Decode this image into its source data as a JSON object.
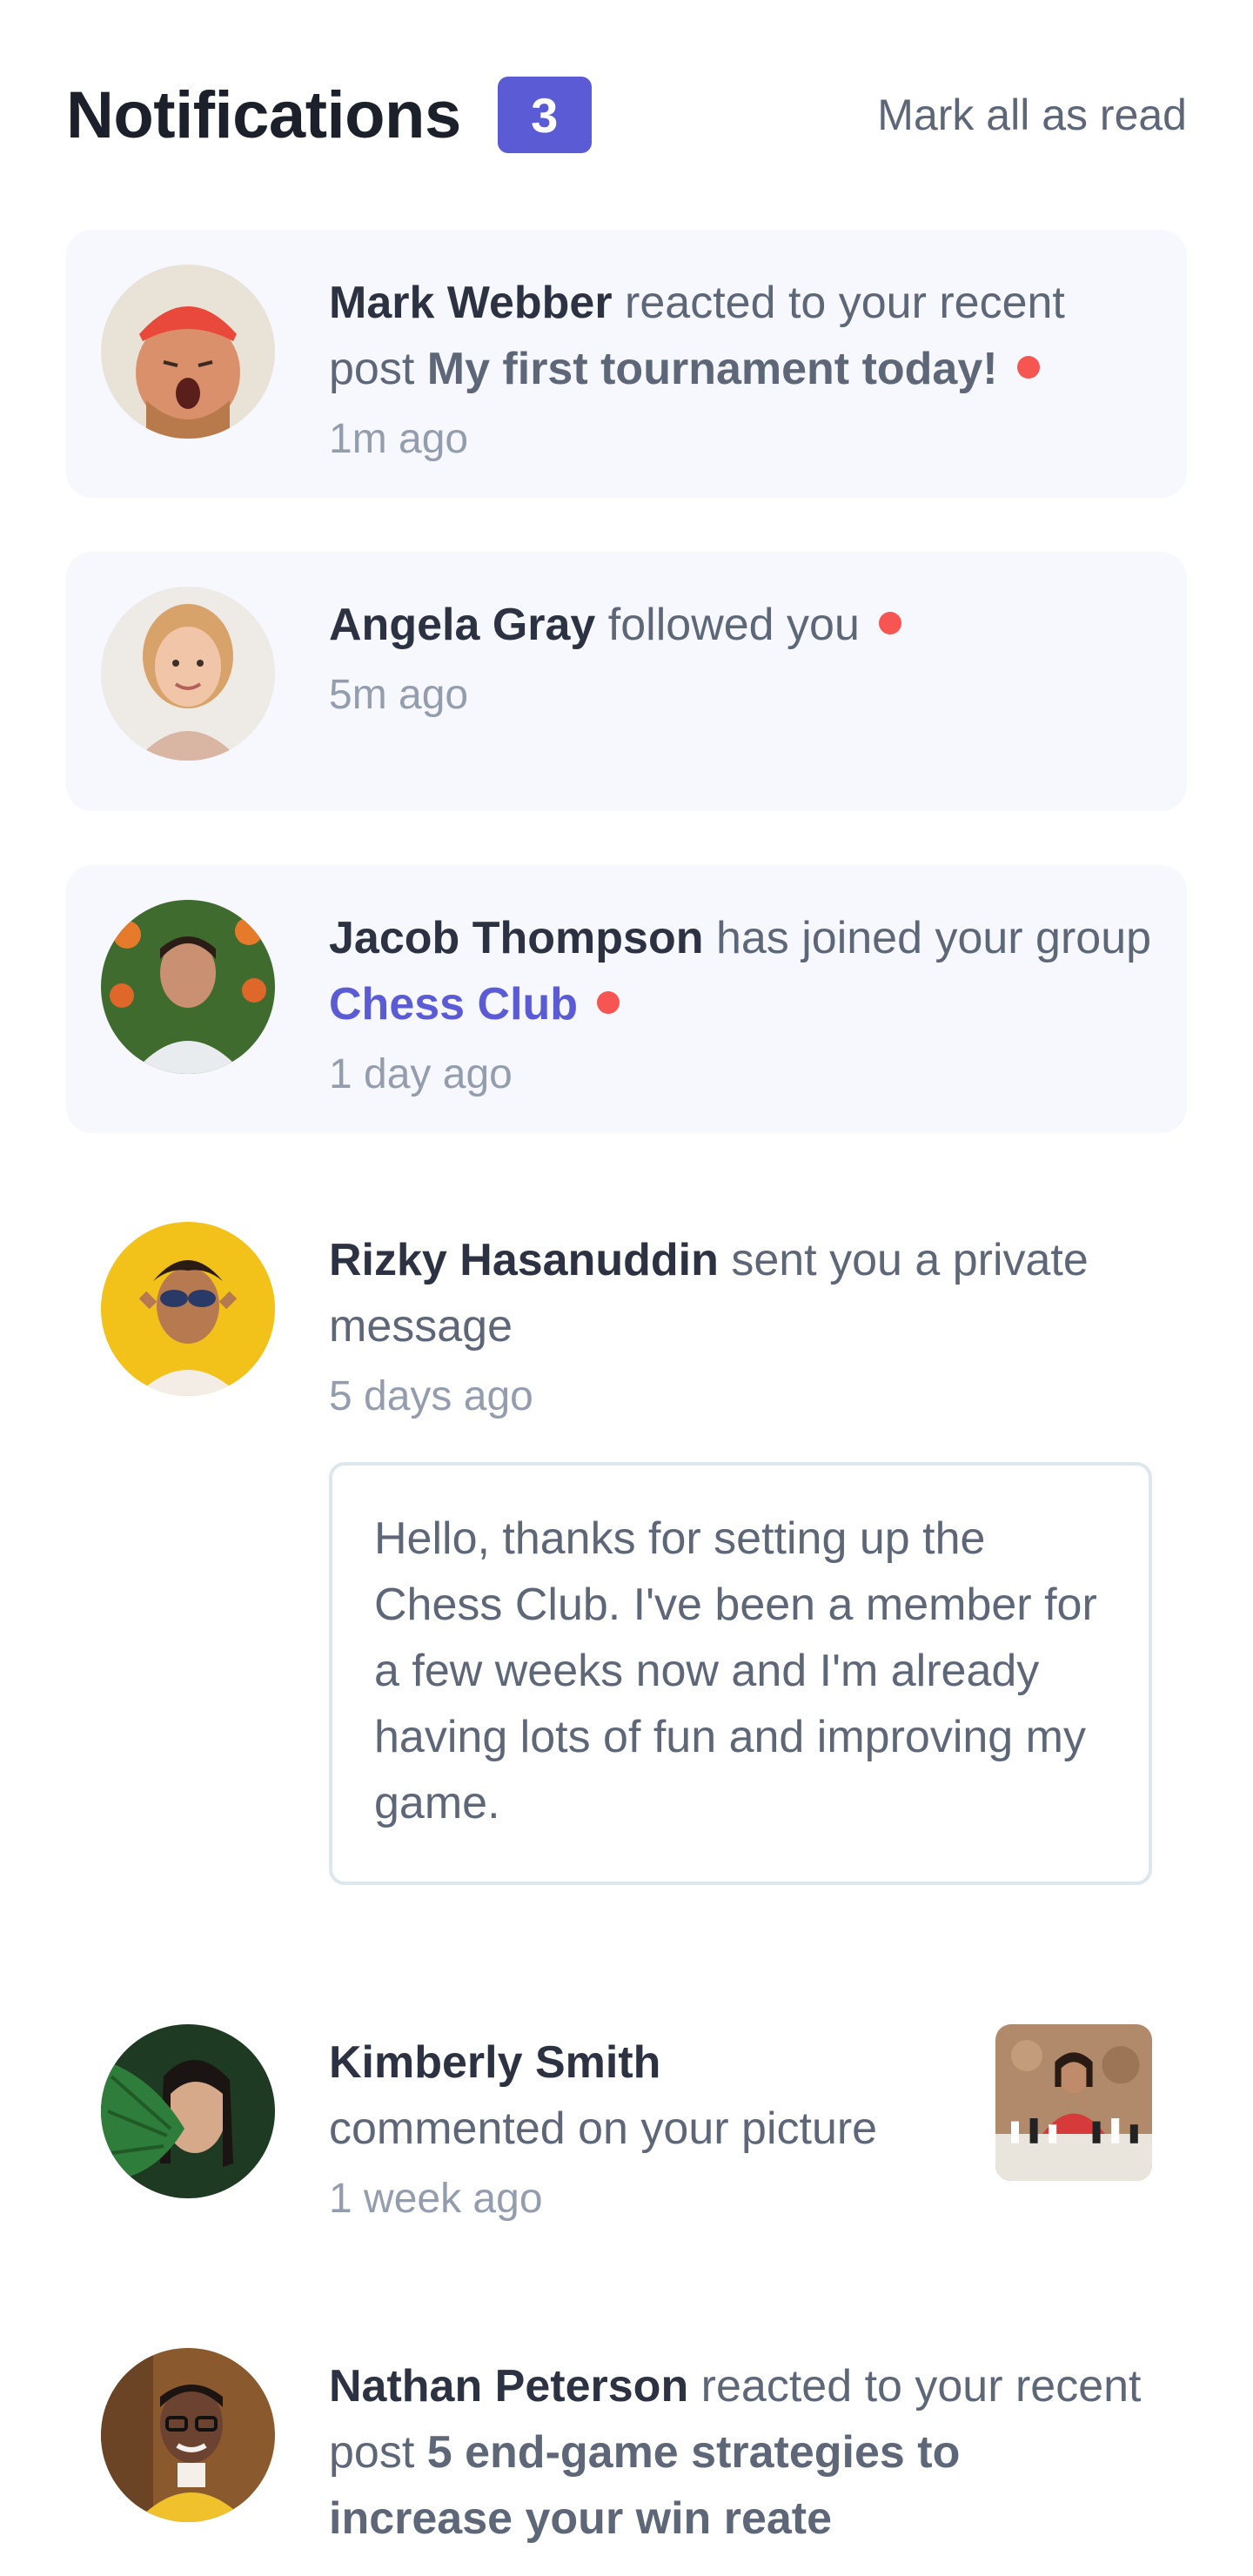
{
  "header": {
    "title": "Notifications",
    "unread_count": "3",
    "mark_all_label": "Mark all as read"
  },
  "colors": {
    "accent": "#5b5bd6",
    "unread_bg": "#f6f8fd",
    "unread_dot": "#f65552",
    "heading": "#1c202b",
    "body_text": "#5e6778",
    "muted_text": "#939dae"
  },
  "notifications": [
    {
      "name": "Mark Webber",
      "action": "reacted to your recent post",
      "post": "My first tournament today!",
      "time": "1m ago",
      "unread": true,
      "avatar_icon": "avatar-mark-webber"
    },
    {
      "name": "Angela Gray",
      "action": "followed you",
      "time": "5m ago",
      "unread": true,
      "avatar_icon": "avatar-angela-gray"
    },
    {
      "name": "Jacob Thompson",
      "action": "has joined your group",
      "group": "Chess Club",
      "time": "1 day ago",
      "unread": true,
      "avatar_icon": "avatar-jacob-thompson"
    },
    {
      "name": "Rizky Hasanuddin",
      "action": "sent you a private message",
      "time": "5 days ago",
      "message": "Hello, thanks for setting up the Chess Club. I've been a member for a few weeks now and I'm already having lots of fun and improving my game.",
      "unread": false,
      "avatar_icon": "avatar-rizky-hasanuddin"
    },
    {
      "name": "Kimberly Smith",
      "action": "commented on your picture",
      "time": "1 week ago",
      "unread": false,
      "avatar_icon": "avatar-kimberly-smith",
      "picture_icon": "chess-picture-thumbnail"
    },
    {
      "name": "Nathan Peterson",
      "action": "reacted to your recent post",
      "post": "5 end-game strategies to increase your win reate",
      "unread": false,
      "avatar_icon": "avatar-nathan-peterson"
    }
  ]
}
